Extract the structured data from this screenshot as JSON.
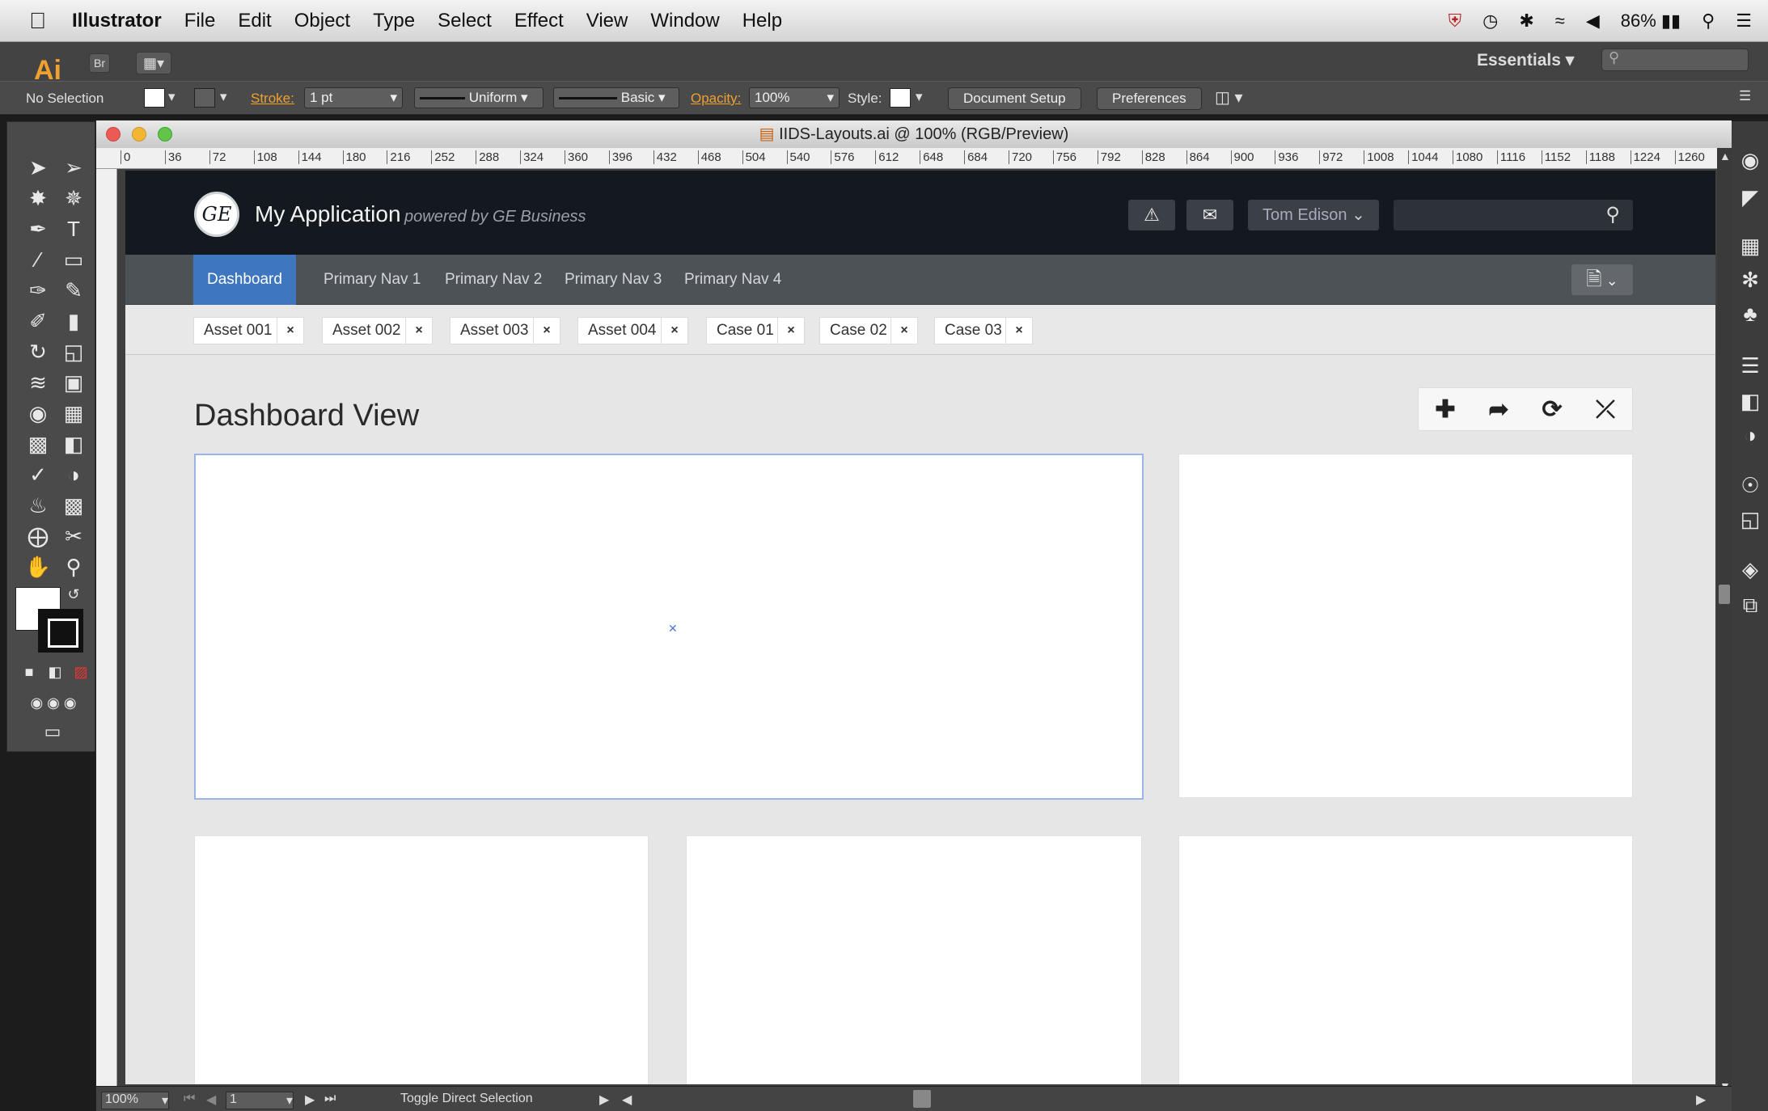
{
  "menubar": {
    "apple": "",
    "app_name": "Illustrator",
    "items": [
      "File",
      "Edit",
      "Object",
      "Type",
      "Select",
      "Effect",
      "View",
      "Window",
      "Help"
    ],
    "battery": "86%"
  },
  "appbar": {
    "logo": "Ai",
    "bridge": "Br",
    "workspace": "Essentials"
  },
  "controlbar": {
    "selection": "No Selection",
    "stroke_label": "Stroke:",
    "stroke_value": "1 pt",
    "profile": "Uniform",
    "brush": "Basic",
    "opacity_label": "Opacity:",
    "opacity_value": "100%",
    "style_label": "Style:",
    "document_setup": "Document Setup",
    "preferences": "Preferences"
  },
  "document": {
    "title": "IIDS-Layouts.ai @ 100% (RGB/Preview)",
    "ruler_ticks": [
      "0",
      "36",
      "72",
      "108",
      "144",
      "180",
      "216",
      "252",
      "288",
      "324",
      "360",
      "396",
      "432",
      "468",
      "504",
      "540",
      "576",
      "612",
      "648",
      "684",
      "720",
      "756",
      "792",
      "828",
      "864",
      "900",
      "936",
      "972",
      "1008",
      "1044",
      "1080",
      "1116",
      "1152",
      "1188",
      "1224",
      "1260"
    ],
    "status": {
      "zoom": "100%",
      "page": "1",
      "tool_hint": "Toggle Direct Selection"
    }
  },
  "app": {
    "logo": "GE",
    "title": "My Application",
    "powered_by": "powered by GE Business",
    "user": "Tom  Edison",
    "nav": [
      "Dashboard",
      "Primary Nav 1",
      "Primary Nav 2",
      "Primary Nav 3",
      "Primary Nav 4"
    ],
    "tabs": [
      "Asset 001",
      "Asset 002",
      "Asset 003",
      "Asset 004",
      "Case 01",
      "Case 02",
      "Case 03"
    ],
    "close_glyph": "×",
    "dashboard_title": "Dashboard View"
  },
  "colors": {
    "header_bg": "#14181f",
    "nav_bg": "#4d5257",
    "nav_active": "#3e76c0",
    "selection_outline": "#9bb3e6",
    "illustrator_orange": "#f0a030"
  },
  "icons": {
    "alert": "warning-icon",
    "mail": "mail-icon",
    "search": "search-icon",
    "add": "plus-icon",
    "share": "share-icon",
    "refresh": "refresh-icon",
    "expand": "expand-icon"
  }
}
